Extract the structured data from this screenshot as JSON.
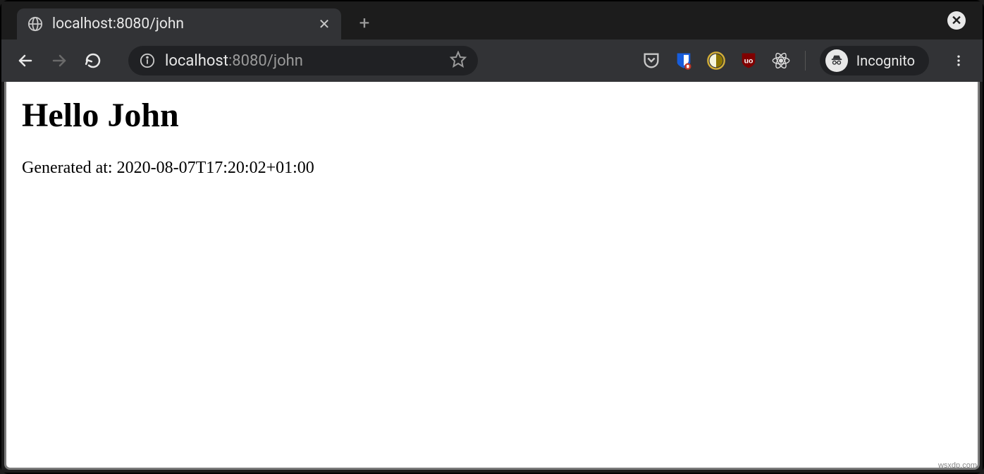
{
  "tab": {
    "title": "localhost:8080/john"
  },
  "address": {
    "host": "localhost",
    "port_path": ":8080/john"
  },
  "incognito": {
    "label": "Incognito"
  },
  "page": {
    "heading": "Hello John",
    "generated_text": "Generated at: 2020-08-07T17:20:02+01:00"
  },
  "watermark": "wsxdp.com"
}
